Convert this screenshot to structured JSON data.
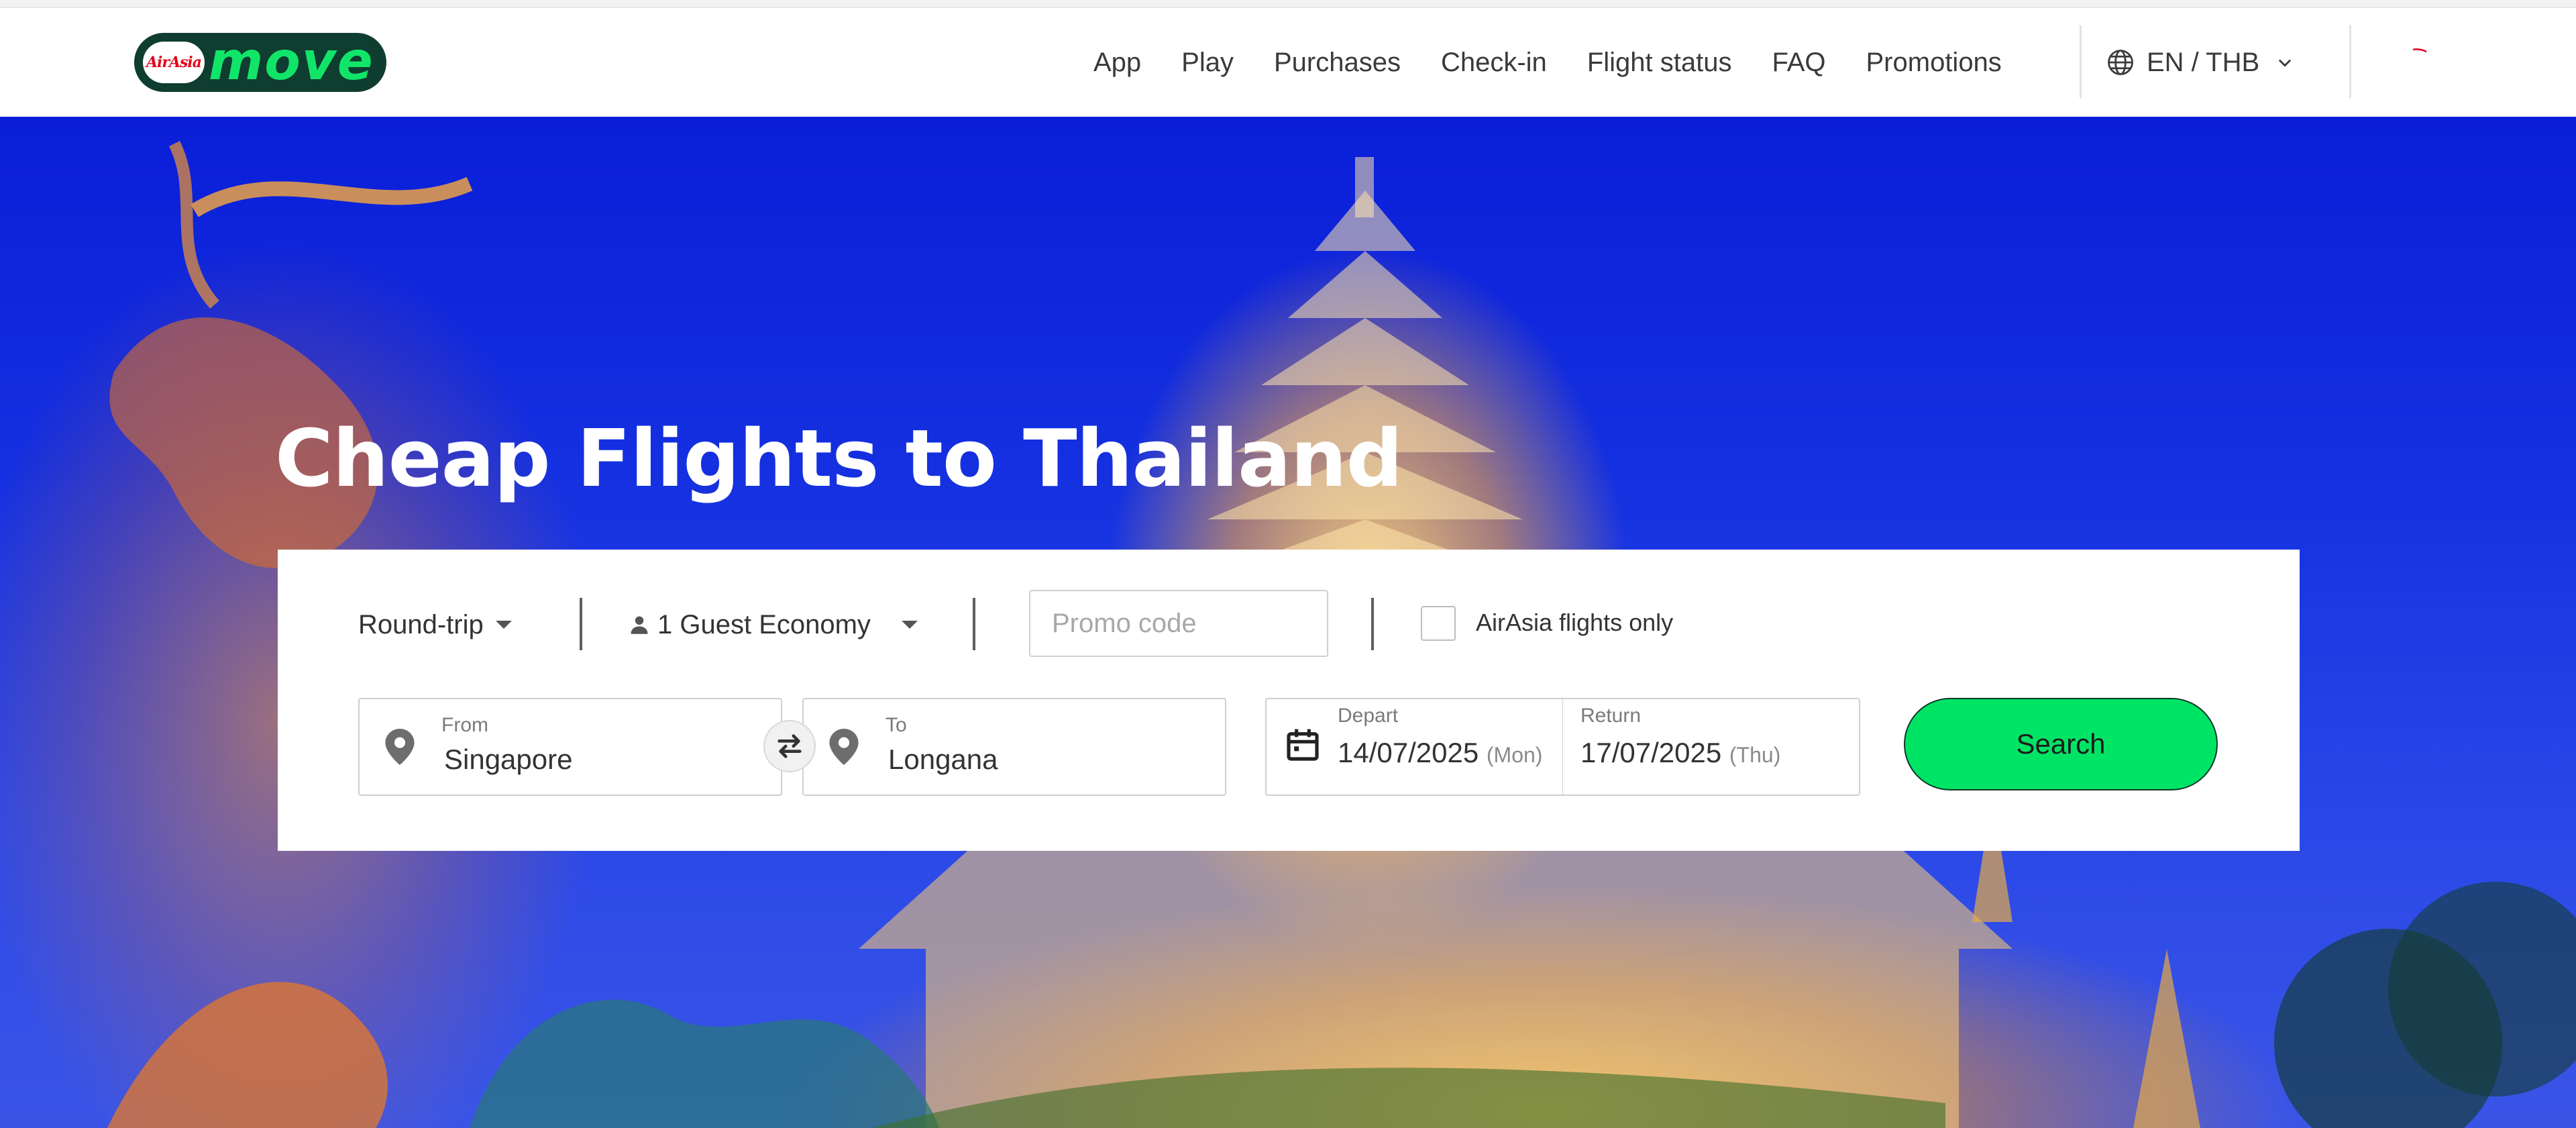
{
  "header": {
    "logo_badge": "AirAsia",
    "logo_word": "move",
    "nav": [
      "App",
      "Play",
      "Purchases",
      "Check-in",
      "Flight status",
      "FAQ",
      "Promotions"
    ],
    "language": "EN / THB"
  },
  "hero": {
    "title": "Cheap Flights to Thailand"
  },
  "search": {
    "trip_type": "Round-trip",
    "guests": "1 Guest Economy",
    "promo_placeholder": "Promo code",
    "airasia_only_label": "AirAsia flights only",
    "airasia_only_checked": false,
    "from_label": "From",
    "from_value": "Singapore",
    "to_label": "To",
    "to_value": "Longana",
    "depart_label": "Depart",
    "depart_date": "14/07/2025",
    "depart_day": "(Mon)",
    "return_label": "Return",
    "return_date": "17/07/2025",
    "return_day": "(Thu)",
    "search_button": "Search"
  },
  "icons": {
    "globe": "globe-icon",
    "chevron": "chevron-down-icon",
    "person": "person-icon",
    "pin": "location-pin-icon",
    "swap": "swap-icon",
    "calendar": "calendar-icon"
  },
  "colors": {
    "brand_green": "#00e466",
    "logo_bg": "#0f3d30",
    "logo_text": "#11e569",
    "sky": "#1430e0"
  }
}
